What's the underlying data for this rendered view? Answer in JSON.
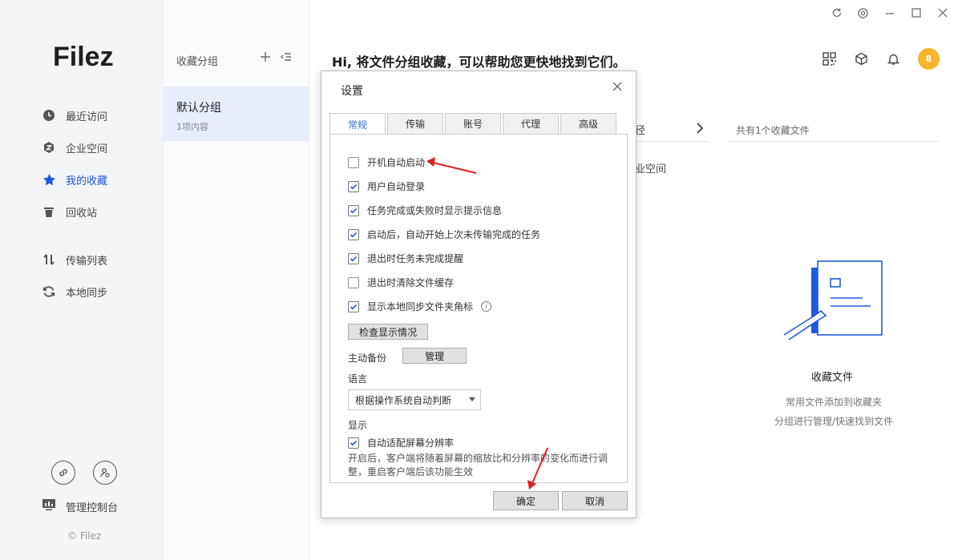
{
  "app": {
    "logo": "Filez",
    "copyright": "© Filez"
  },
  "window_controls": [
    "refresh-icon",
    "settings-icon",
    "minimize-icon",
    "maximize-icon",
    "close-icon"
  ],
  "sidebar": {
    "items": [
      {
        "label": "最近访问",
        "icon": "clock-icon"
      },
      {
        "label": "企业空间",
        "icon": "enterprise-icon"
      },
      {
        "label": "我的收藏",
        "icon": "star-icon",
        "active": true
      },
      {
        "label": "回收站",
        "icon": "trash-icon"
      },
      {
        "label": "传输列表",
        "icon": "transfer-icon"
      },
      {
        "label": "本地同步",
        "icon": "sync-icon"
      }
    ],
    "console_label": "管理控制台"
  },
  "groups": {
    "title": "收藏分组",
    "selected": {
      "name": "默认分组",
      "count": "1项内容"
    }
  },
  "main": {
    "greeting": "Hi, 将文件分组收藏，可以帮助您更快地找到它们。",
    "avatar_text": "8",
    "crumb_fragment": "径",
    "enterprise_fragment": "业空间",
    "fav_count": "共有1个收藏文件",
    "empty_title": "收藏文件",
    "empty_desc1": "常用文件添加到收藏夹",
    "empty_desc2": "分组进行管理/快速找到文件",
    "accent": "#1a57e8",
    "avatar_color": "#f6b52a"
  },
  "dialog": {
    "title": "设置",
    "tabs": [
      "常规",
      "传输",
      "账号",
      "代理",
      "高级"
    ],
    "active_tab": "常规",
    "options": [
      {
        "label": "开机自动启动",
        "checked": false
      },
      {
        "label": "用户自动登录",
        "checked": true
      },
      {
        "label": "任务完成或失败时显示提示信息",
        "checked": true
      },
      {
        "label": "启动后，自动开始上次未传输完成的任务",
        "checked": true
      },
      {
        "label": "退出时任务未完成提醒",
        "checked": true
      },
      {
        "label": "退出时清除文件缓存",
        "checked": false
      },
      {
        "label": "显示本地同步文件夹角标",
        "checked": true
      }
    ],
    "check_display_button": "检查显示情况",
    "backup_label": "主动备份",
    "manage_button": "管理",
    "language_label": "语言",
    "language_value": "根据操作系统自动判断",
    "display_label": "显示",
    "auto_fit": {
      "label": "自动适配屏幕分辨率",
      "checked": true
    },
    "help_text": "开启后，客户端将随着屏幕的缩放比和分辨率的变化而进行调整，重启客户端后该功能生效",
    "ok_button": "确定",
    "cancel_button": "取消"
  },
  "annotations": {
    "arrow_color": "#e02020"
  }
}
